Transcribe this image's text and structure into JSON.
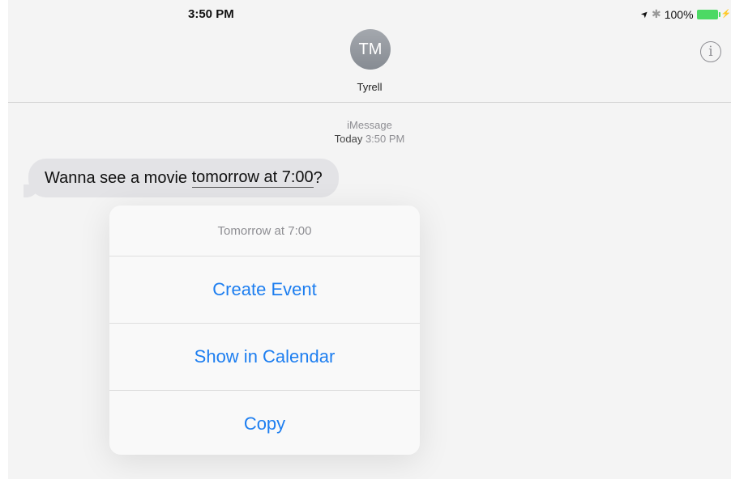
{
  "status_bar": {
    "time": "3:50 PM",
    "location_icon": "➤",
    "bluetooth_icon": "✱",
    "battery_percent": "100%",
    "charging_icon": "⚡"
  },
  "header": {
    "avatar_initials": "TM",
    "contact_name": "Tyrell",
    "info_icon": "i"
  },
  "conversation": {
    "service": "iMessage",
    "timestamp_day": "Today",
    "timestamp_time": "3:50 PM",
    "message": {
      "before": "Wanna see a movie ",
      "detected": "tomorrow at 7:00",
      "after": "?"
    }
  },
  "context_menu": {
    "title": "Tomorrow at 7:00",
    "items": [
      "Create Event",
      "Show in Calendar",
      "Copy"
    ]
  },
  "colors": {
    "accent": "#1d7ef0",
    "battery": "#4cd964",
    "bubble": "#e3e3e6"
  }
}
